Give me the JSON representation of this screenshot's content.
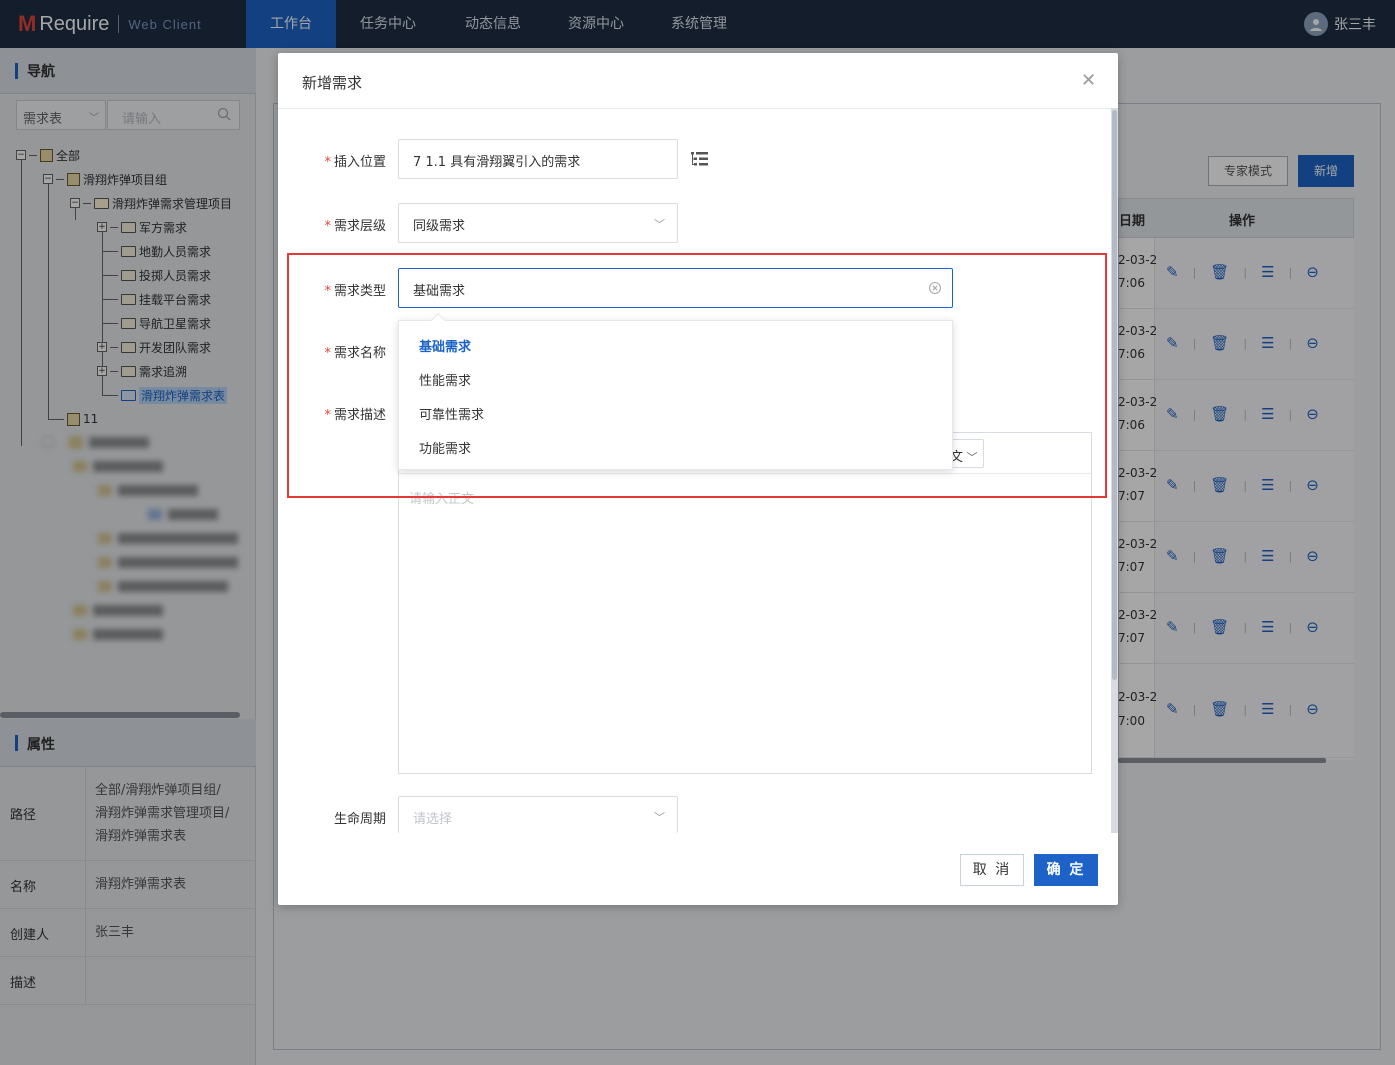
{
  "app": {
    "logo_text": "Require",
    "logo_sub": "Web Client"
  },
  "topnav": {
    "tabs": [
      "工作台",
      "任务中心",
      "动态信息",
      "资源中心",
      "系统管理"
    ],
    "active": 0,
    "user_name": "张三丰"
  },
  "nav_panel": {
    "title": "导航",
    "select_value": "需求表",
    "search_placeholder": "请输入",
    "tree": [
      {
        "label": "全部"
      },
      {
        "label": "滑翔炸弹项目组"
      },
      {
        "label": "滑翔炸弹需求管理项目"
      },
      {
        "label": "军方需求"
      },
      {
        "label": "地勤人员需求"
      },
      {
        "label": "投掷人员需求"
      },
      {
        "label": "挂载平台需求"
      },
      {
        "label": "导航卫星需求"
      },
      {
        "label": "开发团队需求"
      },
      {
        "label": "需求追溯"
      },
      {
        "label": "滑翔炸弹需求表",
        "selected": true
      },
      {
        "label": "11"
      }
    ]
  },
  "props_panel": {
    "title": "属性",
    "rows": [
      {
        "key": "路径",
        "value": "全部/滑翔炸弹项目组/\n滑翔炸弹需求管理项目/\n滑翔炸弹需求表"
      },
      {
        "key": "名称",
        "value": "滑翔炸弹需求表"
      },
      {
        "key": "创建人",
        "value": "张三丰"
      },
      {
        "key": "描述",
        "value": ""
      }
    ]
  },
  "main": {
    "expert_mode_label": "专家模式",
    "add_label": "新增",
    "col_date": "日期",
    "col_ops": "操作",
    "rows": [
      {
        "date_a": "2-03-2",
        "date_b": "7:06"
      },
      {
        "date_a": "2-03-2",
        "date_b": "7:06"
      },
      {
        "date_a": "2-03-2",
        "date_b": "7:06"
      },
      {
        "date_a": "2-03-2",
        "date_b": "7:07"
      },
      {
        "date_a": "2-03-2",
        "date_b": "7:07"
      },
      {
        "date_a": "2-03-2",
        "date_b": "7:07"
      },
      {
        "date_a": "2-03-2",
        "date_b": "7:00"
      }
    ]
  },
  "modal": {
    "title": "新增需求",
    "fields": {
      "insert_position": {
        "label": "插入位置",
        "value": "7 1.1 具有滑翔翼引入的需求"
      },
      "level": {
        "label": "需求层级",
        "value": "同级需求"
      },
      "type": {
        "label": "需求类型",
        "value": "基础需求"
      },
      "name": {
        "label": "需求名称"
      },
      "desc": {
        "label": "需求描述",
        "placeholder": "请输入正文",
        "toolbar_fragment": "文"
      },
      "lifecycle": {
        "label": "生命周期",
        "placeholder": "请选择"
      }
    },
    "type_options": [
      "基础需求",
      "性能需求",
      "可靠性需求",
      "功能需求"
    ],
    "type_selected": 0,
    "cancel_label": "取 消",
    "ok_label": "确 定"
  },
  "colors": {
    "topbar": "#1e2d44",
    "accent": "#1d63c7",
    "highlight_box": "#e53935",
    "required_mark": "#e0443b"
  }
}
